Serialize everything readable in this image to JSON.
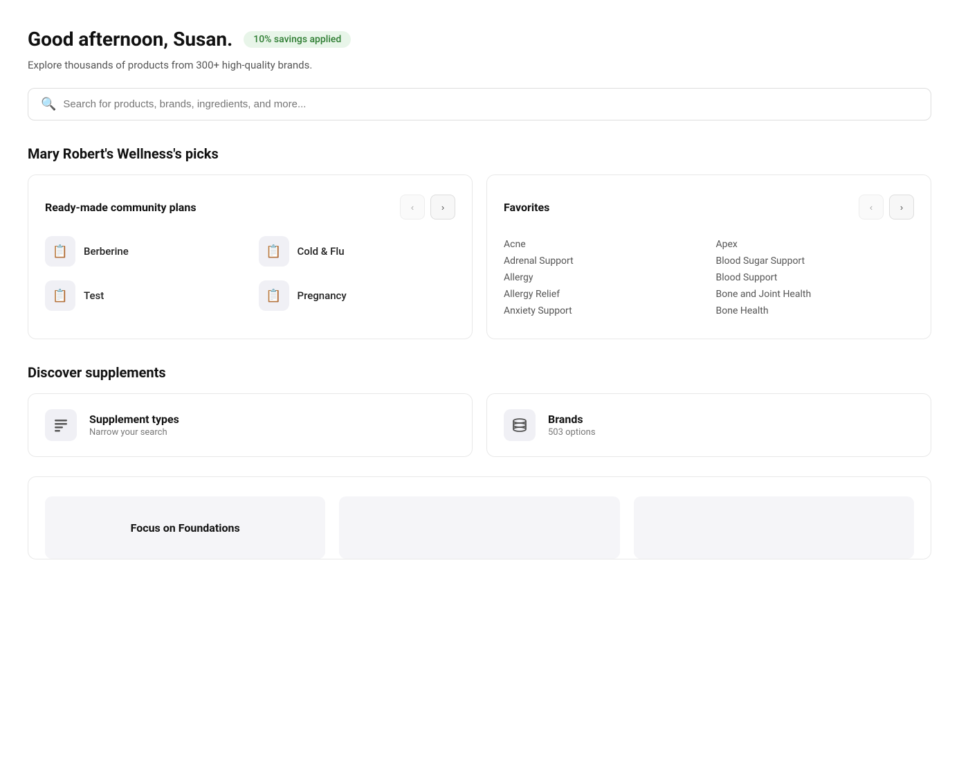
{
  "greeting": {
    "title": "Good afternoon, Susan.",
    "badge": "10% savings applied",
    "subtitle": "Explore thousands of products from 300+ high-quality brands."
  },
  "search": {
    "placeholder": "Search for products, brands, ingredients, and more..."
  },
  "picks_section": {
    "title": "Mary Robert's Wellness's picks"
  },
  "ready_made": {
    "title": "Ready-made community plans",
    "items": [
      {
        "label": "Berberine"
      },
      {
        "label": "Cold & Flu"
      },
      {
        "label": "Test"
      },
      {
        "label": "Pregnancy"
      }
    ]
  },
  "favorites": {
    "title": "Favorites",
    "items_col1": [
      "Acne",
      "Adrenal Support",
      "Allergy",
      "Allergy Relief",
      "Anxiety Support"
    ],
    "items_col2": [
      "Apex",
      "Blood Sugar Support",
      "Blood Support",
      "Bone and Joint Health",
      "Bone Health"
    ]
  },
  "discover": {
    "title": "Discover supplements",
    "supplement_types": {
      "title": "Supplement types",
      "subtitle": "Narrow your search"
    },
    "brands": {
      "title": "Brands",
      "subtitle": "503 options"
    }
  },
  "bottom": {
    "title": "Focus on Foundations"
  },
  "nav": {
    "prev": "‹",
    "next": "›"
  }
}
